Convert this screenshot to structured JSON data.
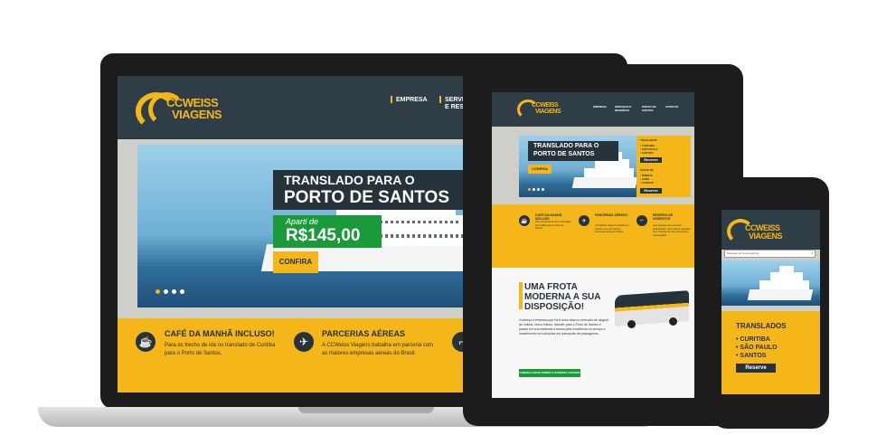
{
  "brand": {
    "name_line1": "CCWEISS",
    "name_line2": "VIAGENS",
    "accent": "#f5b619",
    "dark": "#2f3e46",
    "green": "#1b9a3a"
  },
  "laptop": {
    "nav": [
      "EMPRESA",
      "SERVIÇOS",
      "E RESERV"
    ],
    "hero": {
      "title_line1": "TRANSLADO PARA O",
      "title_line2": "PORTO DE SANTOS",
      "price_prefix": "Aparti de",
      "price": "R$145,00",
      "cta": "CONFIRA"
    },
    "features": [
      {
        "icon": "coffee-icon",
        "title": "CAFÉ DA MANHÃ INCLUSO!",
        "text_line1": "Para os trecho de ida no translado de Curitiba",
        "text_line2": "para o Porto de Santos."
      },
      {
        "icon": "plane-icon",
        "title": "PARCERIAS AÉREAS",
        "text_line1": "A CCWeiss Viagens trabalha em parceria com",
        "text_line2": "as maiores empresas aéreas do Brasil."
      }
    ]
  },
  "tablet": {
    "nav": [
      "EMPRESA",
      "SERVIÇOS E RESERVAS",
      "PORTO DE SANTOS",
      "CONTATO"
    ],
    "hero": {
      "title_line1": "TRANSLADO PARA O",
      "title_line2": "PORTO DE SANTOS",
      "cta": "CONFIRA"
    },
    "side": {
      "heading": "TRASLADOS",
      "items": [
        "• CURITIBA",
        "• SÃO PAULO",
        "• SANTOS"
      ],
      "reserve": "Reserve",
      "heading2": "PASTE DE",
      "items2": [
        "• ÔNIBUS",
        "• VANS",
        "• CARROS"
      ],
      "reserve2": "Reserve"
    },
    "features": [
      {
        "icon": "coffee-icon",
        "title": "CAFÉ DA MANHÃ INCLUSO",
        "text": "Para os trecho de ida no translado de Curitiba para o Porto de Santos."
      },
      {
        "icon": "plane-icon",
        "title": "PARCERIAS AÉREAS",
        "text": "A CCWeiss Viagens trabalha em parceria com as maiores empresas aéreas do Brasil."
      },
      {
        "icon": "seat-icon",
        "title": "RESERVA DE ASSENTOS",
        "text": "para pessoas que possuem preferências, como idosos, pessoas com crianças de colo entre outros necessitados."
      }
    ],
    "fleet": {
      "title_line1": "UMA FROTA",
      "title_line2": "MODERNA A SUA",
      "title_line3": "DISPOSIÇÃO!",
      "text": "Conheça a empresa que há 8 anos atua no mercado de aluguel de ônibus, micro ônibus, transfer para o Porto de Santos e possui em sua essência a busca pela excelência no serviço e investimento em soluções em transporte de passageiros.",
      "cta": "CONHEÇA MAIS SOBRE A CCWEISS VIAGENS"
    }
  },
  "phone": {
    "select_placeholder": "Navegue entre as páginas",
    "heading": "TRANSLADOS",
    "items": [
      "• CURITIBA",
      "• SÃO PAULO",
      "• SANTOS"
    ],
    "reserve": "Reserve"
  }
}
